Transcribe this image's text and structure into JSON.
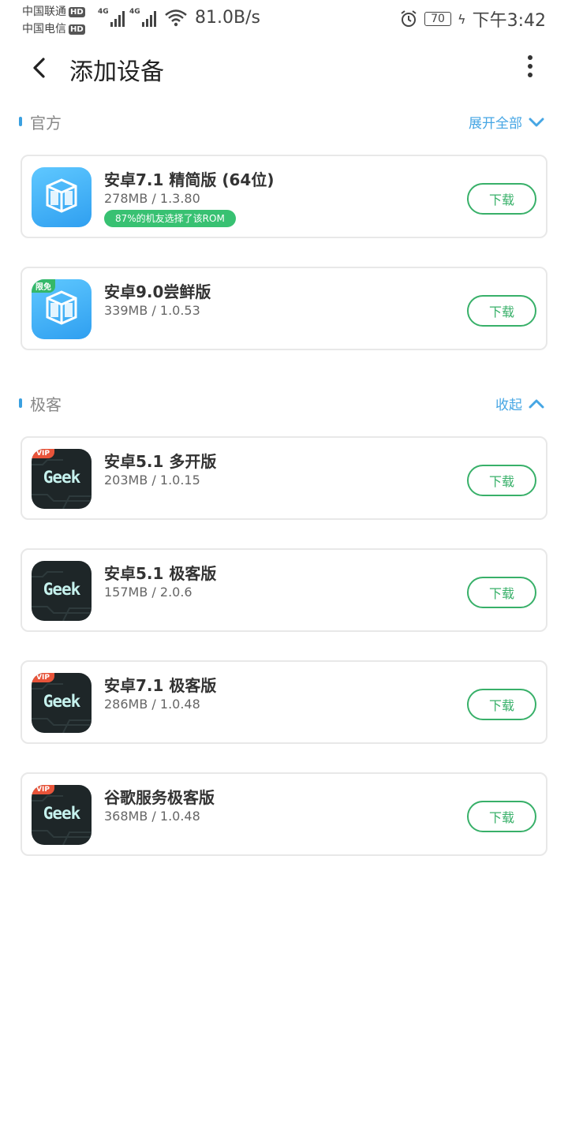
{
  "status_bar": {
    "carrier1": "中国联通",
    "carrier2": "中国电信",
    "hd": "HD",
    "net1": "4G",
    "net2": "4G",
    "speed": "81.0B/s",
    "battery": "70",
    "time": "下午3:42"
  },
  "header": {
    "title": "添加设备"
  },
  "sections": [
    {
      "label": "官方",
      "toggle": "展开全部",
      "items": [
        {
          "name": "安卓7.1 精简版 (64位)",
          "meta": "278MB / 1.3.80",
          "badge": "87%的机友选择了该ROM",
          "action": "下载",
          "icon": "vmos-cube-icon"
        },
        {
          "name": "安卓9.0尝鲜版",
          "meta": "339MB / 1.0.53",
          "tag": "限免",
          "action": "下载",
          "icon": "vmos-cube-icon"
        }
      ]
    },
    {
      "label": "极客",
      "toggle": "收起",
      "items": [
        {
          "name": "安卓5.1 多开版",
          "meta": "203MB / 1.0.15",
          "tag": "VIP",
          "logo": "Geek",
          "action": "下载",
          "icon": "geek-icon"
        },
        {
          "name": "安卓5.1 极客版",
          "meta": "157MB / 2.0.6",
          "logo": "Geek",
          "action": "下载",
          "icon": "geek-icon"
        },
        {
          "name": "安卓7.1 极客版",
          "meta": "286MB / 1.0.48",
          "tag": "VIP",
          "logo": "Geek",
          "action": "下载",
          "icon": "geek-icon"
        },
        {
          "name": "谷歌服务极客版",
          "meta": "368MB / 1.0.48",
          "tag": "VIP",
          "logo": "Geek",
          "action": "下载",
          "icon": "geek-icon"
        }
      ]
    }
  ],
  "colors": {
    "accent": "#46a6e4",
    "download": "#38b069",
    "badge": "#38c172",
    "vip": "#e8543a"
  }
}
